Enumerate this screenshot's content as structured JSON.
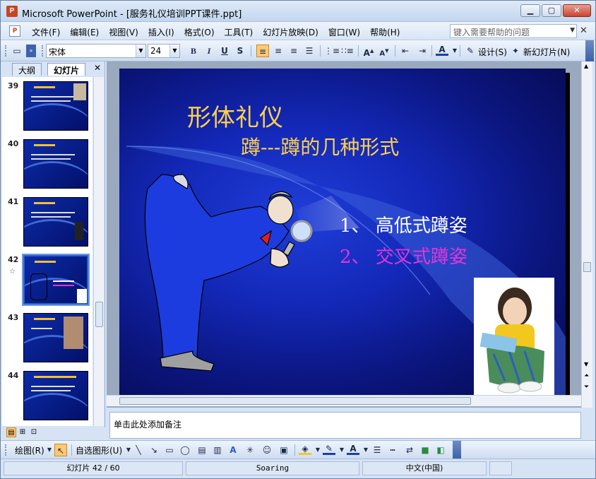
{
  "window": {
    "title": "Microsoft PowerPoint - [服务礼仪培训PPT课件.ppt]",
    "buttons": {
      "minimize": "▁",
      "maximize": "▢",
      "close": "✕"
    }
  },
  "menubar": {
    "items": [
      "文件(F)",
      "编辑(E)",
      "视图(V)",
      "插入(I)",
      "格式(O)",
      "工具(T)",
      "幻灯片放映(D)",
      "窗口(W)",
      "帮助(H)"
    ],
    "help_placeholder": "键入需要帮助的问题",
    "close": "✕"
  },
  "toolbar": {
    "font": "宋体",
    "size": "24",
    "bold": "B",
    "italic": "I",
    "underline": "U",
    "shadow": "S",
    "design": "设计(S)",
    "new_slide": "新幻灯片(N)"
  },
  "left_panel": {
    "tabs": [
      "大纲",
      "幻灯片"
    ],
    "close": "✕",
    "thumbnails": [
      {
        "number": "39"
      },
      {
        "number": "40"
      },
      {
        "number": "41"
      },
      {
        "number": "42",
        "selected": true
      },
      {
        "number": "43"
      },
      {
        "number": "44"
      }
    ]
  },
  "slide": {
    "title": "形体礼仪",
    "subtitle": "蹲---蹲的几种形式",
    "bullets": [
      {
        "text": "1、  高低式蹲姿",
        "color": "#ffffff"
      },
      {
        "text": "2、  交叉式蹲姿",
        "color": "#e633d9"
      }
    ]
  },
  "notes": {
    "placeholder": "单击此处添加备注"
  },
  "drawing_toolbar": {
    "draw": "绘图(R)",
    "autoshapes": "自选图形(U)"
  },
  "statusbar": {
    "slide": "幻灯片 42 / 60",
    "design": "Soaring",
    "language": "中文(中国)"
  }
}
